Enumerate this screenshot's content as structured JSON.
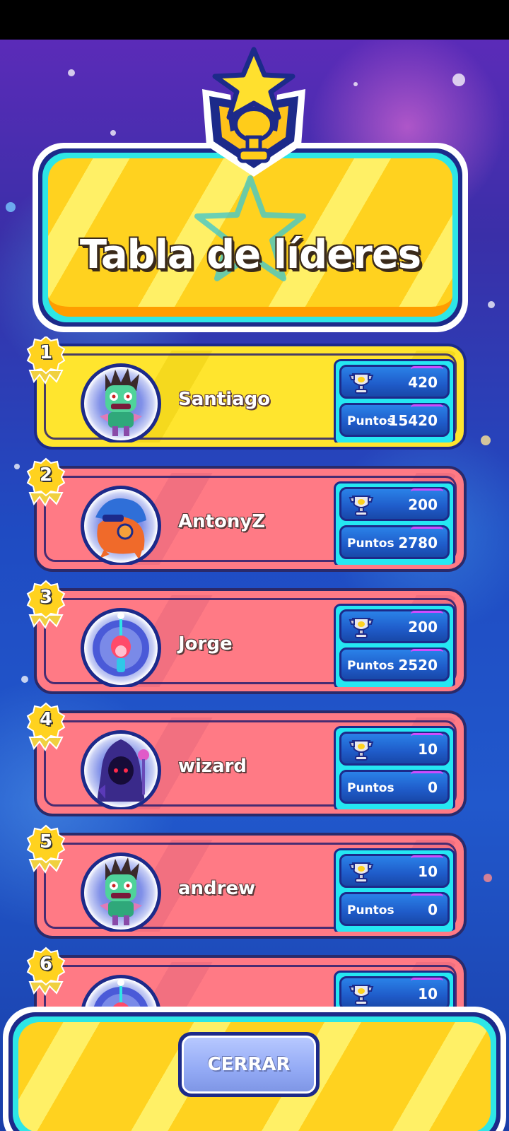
{
  "header": {
    "title": "Tabla de líderes"
  },
  "colors": {
    "gold_row": "#ffe52e",
    "red_row": "#ff7a85",
    "stats_bg": "#25e7f2",
    "pill_blue": "#1f5bc9",
    "outline": "#1c2a8a"
  },
  "leaderboard": {
    "points_label": "Puntos",
    "players": [
      {
        "rank": "1",
        "name": "Santiago",
        "trophies": "420",
        "points": "15420",
        "avatar": "zombie-avatar"
      },
      {
        "rank": "2",
        "name": "AntonyZ",
        "trophies": "200",
        "points": "2780",
        "avatar": "dragon-avatar"
      },
      {
        "rank": "3",
        "name": "Jorge",
        "trophies": "200",
        "points": "2520",
        "avatar": "jester-avatar"
      },
      {
        "rank": "4",
        "name": "wizard",
        "trophies": "10",
        "points": "0",
        "avatar": "hooded-wizard-avatar"
      },
      {
        "rank": "5",
        "name": "andrew",
        "trophies": "10",
        "points": "0",
        "avatar": "zombie-avatar"
      },
      {
        "rank": "6",
        "name": "",
        "trophies": "10",
        "points": "",
        "avatar": "jester-avatar"
      }
    ]
  },
  "footer": {
    "close_label": "CERRAR"
  }
}
